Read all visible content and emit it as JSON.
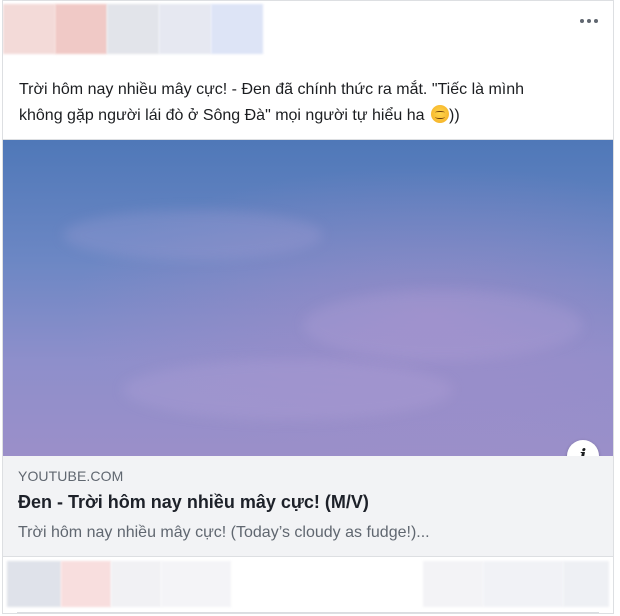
{
  "post": {
    "text_line1": "Trời hôm nay nhiều mây cực! - Đen đã chính thức ra mắt. \"Tiếc là mình",
    "text_line2": "không gặp người lái đò ở Sông Đà\" mọi người tự hiểu ha",
    "text_tail": "))",
    "emoji": "smiling-face-emoji",
    "more_icon": "more-options-icon"
  },
  "link": {
    "domain": "YOUTUBE.COM",
    "title": "Đen - Trời hôm nay nhiều mây cực! (M/V)",
    "description": "Trời hôm nay nhiều mây cực! (Today’s cloudy as fudge!)...",
    "info_label": "i"
  },
  "colors": {
    "card_border": "#dddfe2",
    "meta_bg": "#f2f3f5",
    "text": "#1c1e21",
    "muted": "#606770",
    "sky_top": "#4f78b8",
    "sky_bottom": "#9b8fc9"
  }
}
